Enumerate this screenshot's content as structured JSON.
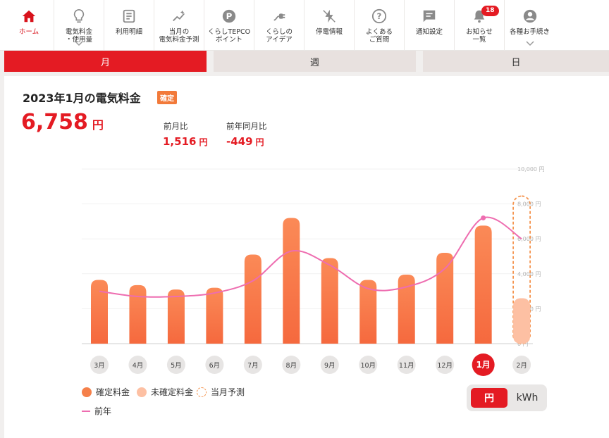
{
  "nav": {
    "items": [
      {
        "label": "ホーム",
        "icon": "home-icon",
        "active": true
      },
      {
        "label": "電気料金\n・使用量",
        "icon": "lightbulb-icon",
        "chevron": true
      },
      {
        "label": "利用明細",
        "icon": "document-icon"
      },
      {
        "label": "当月の\n電気料金予測",
        "icon": "sparkle-chart-icon"
      },
      {
        "label": "くらしTEPCO\nポイント",
        "icon": "points-icon"
      },
      {
        "label": "くらしの\nアイデア",
        "icon": "plug-icon"
      },
      {
        "label": "停電情報",
        "icon": "lightning-icon"
      },
      {
        "label": "よくある\nご質問",
        "icon": "question-icon"
      },
      {
        "label": "通知設定",
        "icon": "message-icon"
      },
      {
        "label": "お知らせ\n一覧",
        "icon": "bell-icon",
        "badge": "18"
      },
      {
        "label": "各種お手続き",
        "icon": "user-icon",
        "chevron": true
      }
    ]
  },
  "tabs": [
    {
      "label": "月",
      "active": true
    },
    {
      "label": "週",
      "active": false
    },
    {
      "label": "日",
      "active": false
    }
  ],
  "summary": {
    "title": "2023年1月の電気料金",
    "status_badge": "確定",
    "amount": "6,758",
    "amount_unit": "円",
    "prev_month_label": "前月比",
    "prev_month_value": "1,516",
    "prev_year_label": "前年同月比",
    "prev_year_value": "-449",
    "value_unit": "円"
  },
  "chart_data": {
    "type": "bar",
    "categories": [
      "3月",
      "4月",
      "5月",
      "6月",
      "7月",
      "8月",
      "9月",
      "10月",
      "11月",
      "12月",
      "1月",
      "2月"
    ],
    "series": [
      {
        "name": "確定料金",
        "values": [
          3650,
          3350,
          3100,
          3200,
          5100,
          7200,
          4900,
          3650,
          3950,
          5200,
          6758,
          null
        ]
      },
      {
        "name": "未確定料金",
        "values": [
          null,
          null,
          null,
          null,
          null,
          null,
          null,
          null,
          null,
          null,
          null,
          2600
        ]
      },
      {
        "name": "当月予測",
        "values": [
          null,
          null,
          null,
          null,
          null,
          null,
          null,
          null,
          null,
          null,
          null,
          8450
        ]
      },
      {
        "name": "前年",
        "type": "line",
        "values": [
          3000,
          2700,
          2700,
          2900,
          3600,
          5300,
          4500,
          3150,
          3250,
          4300,
          7200,
          6000
        ]
      }
    ],
    "selected_category": "1月",
    "y_ticks": [
      "10,000 円",
      "8,000 円",
      "6,000 円",
      "4,000 円",
      "2,000 円",
      "0 円"
    ],
    "y_tick_values": [
      10000,
      8000,
      6000,
      4000,
      2000,
      0
    ],
    "ylim": [
      0,
      10000
    ],
    "grid": true,
    "legend_position": "bottom-left",
    "colors": {
      "confirmed": "#f5693e",
      "confirmed_top": "#fb8a57",
      "unconfirmed": "#fdc0a3",
      "forecast": "#f5944f",
      "prev_year": "#ee6db0",
      "selected": "#e41b23"
    }
  },
  "legend": [
    {
      "label": "確定料金",
      "kind": "confirmed"
    },
    {
      "label": "未確定料金",
      "kind": "unconfirmed"
    },
    {
      "label": "当月予測",
      "kind": "forecast"
    },
    {
      "label": "前年",
      "kind": "line"
    }
  ],
  "unit_toggle": {
    "yen": "円",
    "kwh": "kWh",
    "selected": "yen"
  }
}
